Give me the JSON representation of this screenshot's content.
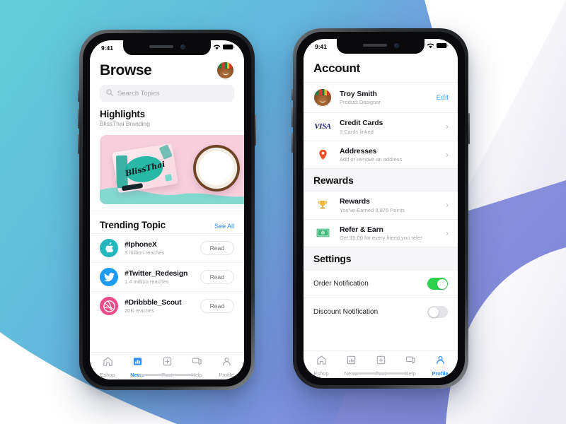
{
  "background": {
    "gradient_start": "#63ccd8",
    "gradient_end": "#7f9ae0",
    "accent_shape": "#8089d8",
    "page": "#ffffff"
  },
  "phone_left": {
    "status_bar": {
      "time": "9:41",
      "cellular_icon": "signal-icon",
      "wifi_icon": "wifi-icon",
      "battery_icon": "battery-icon"
    },
    "header": {
      "title": "Browse",
      "avatar_icon": "user-avatar"
    },
    "search": {
      "placeholder": "Search Topics",
      "icon": "search-icon"
    },
    "highlights": {
      "title": "Highlights",
      "subtitle": "BlissThai Branding",
      "card_brand": "BlissThai"
    },
    "trending": {
      "title": "Trending Topic",
      "see_all": "See All",
      "items": [
        {
          "tag": "#IphoneX",
          "reach": "3 million reaches",
          "action": "Read",
          "icon": "apple-icon",
          "icon_color": "#25b7bd"
        },
        {
          "tag": "#Twitter_Redesign",
          "reach": "1.4 million reaches",
          "action": "Read",
          "icon": "twitter-icon",
          "icon_color": "#1d9bf0"
        },
        {
          "tag": "#Dribbble_Scout",
          "reach": "20K reaches",
          "action": "Read",
          "icon": "dribbble-icon",
          "icon_color": "#ea4c89"
        }
      ]
    },
    "tabs": [
      {
        "label": "Eshop",
        "icon": "home-icon",
        "active": false
      },
      {
        "label": "News",
        "icon": "news-icon",
        "active": true
      },
      {
        "label": "Post",
        "icon": "post-icon",
        "active": false
      },
      {
        "label": "Help",
        "icon": "chat-icon",
        "active": false
      },
      {
        "label": "Profile",
        "icon": "person-icon",
        "active": false
      }
    ],
    "active_tab_color": "#2d8cf7"
  },
  "phone_right": {
    "status_bar": {
      "time": "9:41",
      "cellular_icon": "signal-icon",
      "wifi_icon": "wifi-icon",
      "battery_icon": "battery-icon"
    },
    "header": {
      "title": "Account"
    },
    "profile": {
      "name": "Troy Smith",
      "role": "Product Designer",
      "edit_label": "Edit",
      "avatar_icon": "user-avatar"
    },
    "rows": [
      {
        "label": "Credit Cards",
        "sub": "3 Cards linked",
        "icon": "visa-logo",
        "badge": "VISA"
      },
      {
        "label": "Addresses",
        "sub": "Add or remove an address",
        "icon": "location-pin-icon"
      }
    ],
    "rewards_group": {
      "title": "Rewards",
      "rows": [
        {
          "label": "Rewards",
          "sub": "You've Earned 8,876 Points",
          "icon": "trophy-icon"
        },
        {
          "label": "Refer & Earn",
          "sub": "Get $5.00 for every friend you refer",
          "icon": "money-icon"
        }
      ]
    },
    "settings_group": {
      "title": "Settings",
      "rows": [
        {
          "label": "Order Notification",
          "enabled": true
        },
        {
          "label": "Discount Notification",
          "enabled": false
        }
      ],
      "toggle_on_color": "#2ed14e",
      "toggle_off_color": "#e4e4e8"
    },
    "tabs": [
      {
        "label": "Eshop",
        "icon": "home-icon",
        "active": false
      },
      {
        "label": "News",
        "icon": "news-icon",
        "active": false
      },
      {
        "label": "Post",
        "icon": "post-icon",
        "active": false
      },
      {
        "label": "Help",
        "icon": "chat-icon",
        "active": false
      },
      {
        "label": "Profile",
        "icon": "person-icon",
        "active": true
      }
    ],
    "active_tab_color": "#2d8cf7"
  }
}
